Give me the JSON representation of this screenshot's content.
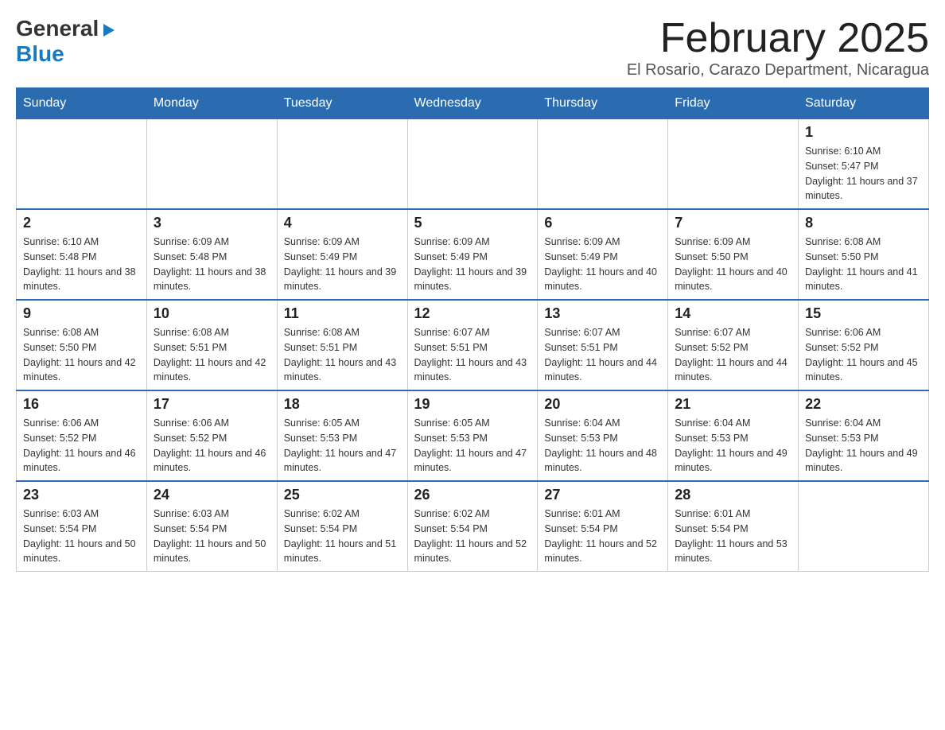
{
  "logo": {
    "general": "General",
    "blue": "Blue",
    "triangle": "▶"
  },
  "title": "February 2025",
  "location": "El Rosario, Carazo Department, Nicaragua",
  "days_header": [
    "Sunday",
    "Monday",
    "Tuesday",
    "Wednesday",
    "Thursday",
    "Friday",
    "Saturday"
  ],
  "weeks": [
    [
      {
        "day": "",
        "info": ""
      },
      {
        "day": "",
        "info": ""
      },
      {
        "day": "",
        "info": ""
      },
      {
        "day": "",
        "info": ""
      },
      {
        "day": "",
        "info": ""
      },
      {
        "day": "",
        "info": ""
      },
      {
        "day": "1",
        "info": "Sunrise: 6:10 AM\nSunset: 5:47 PM\nDaylight: 11 hours and 37 minutes."
      }
    ],
    [
      {
        "day": "2",
        "info": "Sunrise: 6:10 AM\nSunset: 5:48 PM\nDaylight: 11 hours and 38 minutes."
      },
      {
        "day": "3",
        "info": "Sunrise: 6:09 AM\nSunset: 5:48 PM\nDaylight: 11 hours and 38 minutes."
      },
      {
        "day": "4",
        "info": "Sunrise: 6:09 AM\nSunset: 5:49 PM\nDaylight: 11 hours and 39 minutes."
      },
      {
        "day": "5",
        "info": "Sunrise: 6:09 AM\nSunset: 5:49 PM\nDaylight: 11 hours and 39 minutes."
      },
      {
        "day": "6",
        "info": "Sunrise: 6:09 AM\nSunset: 5:49 PM\nDaylight: 11 hours and 40 minutes."
      },
      {
        "day": "7",
        "info": "Sunrise: 6:09 AM\nSunset: 5:50 PM\nDaylight: 11 hours and 40 minutes."
      },
      {
        "day": "8",
        "info": "Sunrise: 6:08 AM\nSunset: 5:50 PM\nDaylight: 11 hours and 41 minutes."
      }
    ],
    [
      {
        "day": "9",
        "info": "Sunrise: 6:08 AM\nSunset: 5:50 PM\nDaylight: 11 hours and 42 minutes."
      },
      {
        "day": "10",
        "info": "Sunrise: 6:08 AM\nSunset: 5:51 PM\nDaylight: 11 hours and 42 minutes."
      },
      {
        "day": "11",
        "info": "Sunrise: 6:08 AM\nSunset: 5:51 PM\nDaylight: 11 hours and 43 minutes."
      },
      {
        "day": "12",
        "info": "Sunrise: 6:07 AM\nSunset: 5:51 PM\nDaylight: 11 hours and 43 minutes."
      },
      {
        "day": "13",
        "info": "Sunrise: 6:07 AM\nSunset: 5:51 PM\nDaylight: 11 hours and 44 minutes."
      },
      {
        "day": "14",
        "info": "Sunrise: 6:07 AM\nSunset: 5:52 PM\nDaylight: 11 hours and 44 minutes."
      },
      {
        "day": "15",
        "info": "Sunrise: 6:06 AM\nSunset: 5:52 PM\nDaylight: 11 hours and 45 minutes."
      }
    ],
    [
      {
        "day": "16",
        "info": "Sunrise: 6:06 AM\nSunset: 5:52 PM\nDaylight: 11 hours and 46 minutes."
      },
      {
        "day": "17",
        "info": "Sunrise: 6:06 AM\nSunset: 5:52 PM\nDaylight: 11 hours and 46 minutes."
      },
      {
        "day": "18",
        "info": "Sunrise: 6:05 AM\nSunset: 5:53 PM\nDaylight: 11 hours and 47 minutes."
      },
      {
        "day": "19",
        "info": "Sunrise: 6:05 AM\nSunset: 5:53 PM\nDaylight: 11 hours and 47 minutes."
      },
      {
        "day": "20",
        "info": "Sunrise: 6:04 AM\nSunset: 5:53 PM\nDaylight: 11 hours and 48 minutes."
      },
      {
        "day": "21",
        "info": "Sunrise: 6:04 AM\nSunset: 5:53 PM\nDaylight: 11 hours and 49 minutes."
      },
      {
        "day": "22",
        "info": "Sunrise: 6:04 AM\nSunset: 5:53 PM\nDaylight: 11 hours and 49 minutes."
      }
    ],
    [
      {
        "day": "23",
        "info": "Sunrise: 6:03 AM\nSunset: 5:54 PM\nDaylight: 11 hours and 50 minutes."
      },
      {
        "day": "24",
        "info": "Sunrise: 6:03 AM\nSunset: 5:54 PM\nDaylight: 11 hours and 50 minutes."
      },
      {
        "day": "25",
        "info": "Sunrise: 6:02 AM\nSunset: 5:54 PM\nDaylight: 11 hours and 51 minutes."
      },
      {
        "day": "26",
        "info": "Sunrise: 6:02 AM\nSunset: 5:54 PM\nDaylight: 11 hours and 52 minutes."
      },
      {
        "day": "27",
        "info": "Sunrise: 6:01 AM\nSunset: 5:54 PM\nDaylight: 11 hours and 52 minutes."
      },
      {
        "day": "28",
        "info": "Sunrise: 6:01 AM\nSunset: 5:54 PM\nDaylight: 11 hours and 53 minutes."
      },
      {
        "day": "",
        "info": ""
      }
    ]
  ]
}
